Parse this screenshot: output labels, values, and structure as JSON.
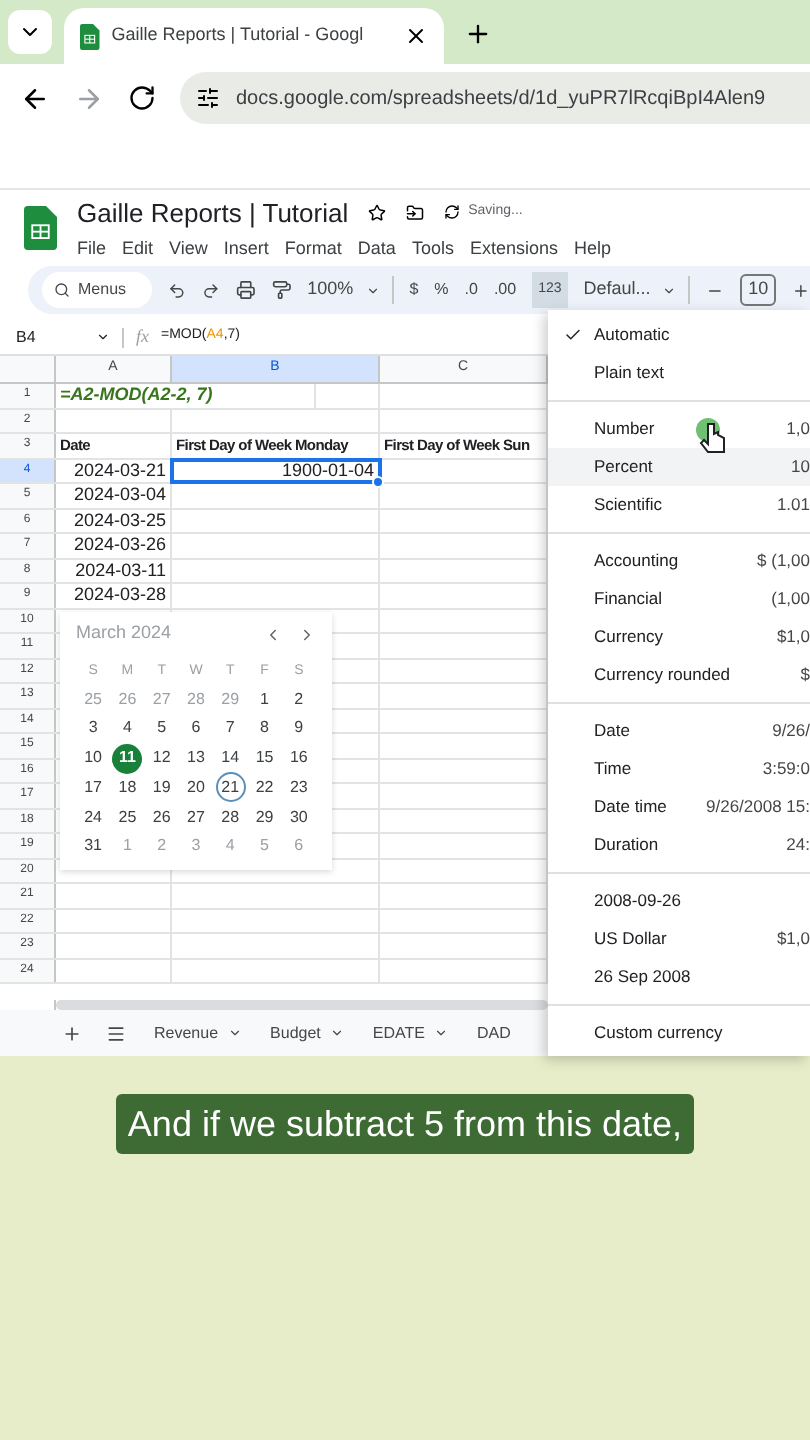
{
  "browser": {
    "tab_title": "Gaille Reports | Tutorial - Googl",
    "url": "docs.google.com/spreadsheets/d/1d_yuPR7lRcqiBpI4Alen9"
  },
  "document": {
    "title": "Gaille Reports | Tutorial",
    "status": "Saving...",
    "menu": [
      "File",
      "Edit",
      "View",
      "Insert",
      "Format",
      "Data",
      "Tools",
      "Extensions",
      "Help"
    ]
  },
  "toolbar": {
    "search": "Menus",
    "zoom": "100%",
    "currency": "$",
    "percent": "%",
    "decrease_decimals": ".0",
    "increase_decimals": ".00",
    "format_button": {
      "label": "123",
      "selected": true
    },
    "font": "Defaul...",
    "font_size": "10"
  },
  "formula_bar": {
    "cell": "B4",
    "fx_label": "fx",
    "formula": [
      {
        "text": "=MOD(",
        "kind": "plain"
      },
      {
        "text": "A4",
        "kind": "ref"
      },
      {
        "text": ",7)",
        "kind": "plain"
      }
    ]
  },
  "grid": {
    "columns": [
      {
        "label": "A",
        "selected": false
      },
      {
        "label": "B",
        "selected": true
      },
      {
        "label": "C",
        "selected": false
      }
    ],
    "rows": [
      {
        "number": "1",
        "selected": false,
        "a": {
          "text": "=A2-MOD(A2-2, 7)",
          "kind": "formula",
          "selected": false
        }
      },
      {
        "number": "2",
        "selected": false
      },
      {
        "number": "3",
        "selected": false,
        "a": {
          "text": "Date",
          "kind": "header",
          "selected": false
        },
        "b": {
          "text": "First Day of Week Monday",
          "kind": "header",
          "selected": false
        },
        "c": {
          "text": "First Day of Week Sun",
          "kind": "header",
          "selected": false
        }
      },
      {
        "number": "4",
        "selected": true,
        "a": {
          "text": "2024-03-21",
          "kind": "value",
          "selected": false
        },
        "b": {
          "text": "1900-01-04",
          "kind": "value",
          "selected": true
        }
      },
      {
        "number": "5",
        "selected": false,
        "a": {
          "text": "2024-03-04",
          "kind": "value",
          "selected": false
        }
      },
      {
        "number": "6",
        "selected": false,
        "a": {
          "text": "2024-03-25",
          "kind": "value",
          "selected": false
        }
      },
      {
        "number": "7",
        "selected": false,
        "a": {
          "text": "2024-03-26",
          "kind": "value",
          "selected": false
        }
      },
      {
        "number": "8",
        "selected": false,
        "a": {
          "text": "2024-03-11",
          "kind": "value",
          "selected": false
        }
      },
      {
        "number": "9",
        "selected": false,
        "a": {
          "text": "2024-03-28",
          "kind": "value",
          "selected": false
        }
      },
      {
        "number": "10",
        "selected": false
      },
      {
        "number": "11",
        "selected": false
      },
      {
        "number": "12",
        "selected": false
      },
      {
        "number": "13",
        "selected": false
      },
      {
        "number": "14",
        "selected": false
      },
      {
        "number": "15",
        "selected": false
      },
      {
        "number": "16",
        "selected": false
      },
      {
        "number": "17",
        "selected": false
      },
      {
        "number": "18",
        "selected": false
      },
      {
        "number": "19",
        "selected": false
      },
      {
        "number": "20",
        "selected": false
      },
      {
        "number": "21",
        "selected": false
      },
      {
        "number": "22",
        "selected": false
      },
      {
        "number": "23",
        "selected": false
      },
      {
        "number": "24",
        "selected": false
      }
    ]
  },
  "date_picker": {
    "title": "March 2024",
    "weekdays": [
      "S",
      "M",
      "T",
      "W",
      "T",
      "F",
      "S"
    ],
    "weeks": [
      [
        {
          "day": "25",
          "muted": true,
          "selected": false,
          "circled": false
        },
        {
          "day": "26",
          "muted": true,
          "selected": false,
          "circled": false
        },
        {
          "day": "27",
          "muted": true,
          "selected": false,
          "circled": false
        },
        {
          "day": "28",
          "muted": true,
          "selected": false,
          "circled": false
        },
        {
          "day": "29",
          "muted": true,
          "selected": false,
          "circled": false
        },
        {
          "day": "1",
          "muted": false,
          "selected": false,
          "circled": false
        },
        {
          "day": "2",
          "muted": false,
          "selected": false,
          "circled": false
        }
      ],
      [
        {
          "day": "3",
          "muted": false,
          "selected": false,
          "circled": false
        },
        {
          "day": "4",
          "muted": false,
          "selected": false,
          "circled": false
        },
        {
          "day": "5",
          "muted": false,
          "selected": false,
          "circled": false
        },
        {
          "day": "6",
          "muted": false,
          "selected": false,
          "circled": false
        },
        {
          "day": "7",
          "muted": false,
          "selected": false,
          "circled": false
        },
        {
          "day": "8",
          "muted": false,
          "selected": false,
          "circled": false
        },
        {
          "day": "9",
          "muted": false,
          "selected": false,
          "circled": false
        }
      ],
      [
        {
          "day": "10",
          "muted": false,
          "selected": false,
          "circled": false
        },
        {
          "day": "11",
          "muted": false,
          "selected": true,
          "circled": false
        },
        {
          "day": "12",
          "muted": false,
          "selected": false,
          "circled": false
        },
        {
          "day": "13",
          "muted": false,
          "selected": false,
          "circled": false
        },
        {
          "day": "14",
          "muted": false,
          "selected": false,
          "circled": false
        },
        {
          "day": "15",
          "muted": false,
          "selected": false,
          "circled": false
        },
        {
          "day": "16",
          "muted": false,
          "selected": false,
          "circled": false
        }
      ],
      [
        {
          "day": "17",
          "muted": false,
          "selected": false,
          "circled": false
        },
        {
          "day": "18",
          "muted": false,
          "selected": false,
          "circled": false
        },
        {
          "day": "19",
          "muted": false,
          "selected": false,
          "circled": false
        },
        {
          "day": "20",
          "muted": false,
          "selected": false,
          "circled": false
        },
        {
          "day": "21",
          "muted": false,
          "selected": false,
          "circled": true
        },
        {
          "day": "22",
          "muted": false,
          "selected": false,
          "circled": false
        },
        {
          "day": "23",
          "muted": false,
          "selected": false,
          "circled": false
        }
      ],
      [
        {
          "day": "24",
          "muted": false,
          "selected": false,
          "circled": false
        },
        {
          "day": "25",
          "muted": false,
          "selected": false,
          "circled": false
        },
        {
          "day": "26",
          "muted": false,
          "selected": false,
          "circled": false
        },
        {
          "day": "27",
          "muted": false,
          "selected": false,
          "circled": false
        },
        {
          "day": "28",
          "muted": false,
          "selected": false,
          "circled": false
        },
        {
          "day": "29",
          "muted": false,
          "selected": false,
          "circled": false
        },
        {
          "day": "30",
          "muted": false,
          "selected": false,
          "circled": false
        }
      ],
      [
        {
          "day": "31",
          "muted": false,
          "selected": false,
          "circled": false
        },
        {
          "day": "1",
          "muted": true,
          "selected": false,
          "circled": false
        },
        {
          "day": "2",
          "muted": true,
          "selected": false,
          "circled": false
        },
        {
          "day": "3",
          "muted": true,
          "selected": false,
          "circled": false
        },
        {
          "day": "4",
          "muted": true,
          "selected": false,
          "circled": false
        },
        {
          "day": "5",
          "muted": true,
          "selected": false,
          "circled": false
        },
        {
          "day": "6",
          "muted": true,
          "selected": false,
          "circled": false
        }
      ]
    ]
  },
  "sheet_tabs": [
    "Revenue",
    "Budget",
    "EDATE",
    "DAD"
  ],
  "format_menu": {
    "groups": [
      [
        {
          "label": "Automatic",
          "checked": true,
          "highlighted": false
        },
        {
          "label": "Plain text",
          "checked": false,
          "highlighted": false
        }
      ],
      [
        {
          "label": "Number",
          "sample": "1,0",
          "checked": false,
          "highlighted": false
        },
        {
          "label": "Percent",
          "sample": "10",
          "checked": false,
          "highlighted": true
        },
        {
          "label": "Scientific",
          "sample": "1.01",
          "checked": false,
          "highlighted": false
        }
      ],
      [
        {
          "label": "Accounting",
          "sample": "$ (1,00",
          "checked": false,
          "highlighted": false
        },
        {
          "label": "Financial",
          "sample": "(1,00",
          "checked": false,
          "highlighted": false
        },
        {
          "label": "Currency",
          "sample": "$1,0",
          "checked": false,
          "highlighted": false
        },
        {
          "label": "Currency rounded",
          "sample": "$",
          "checked": false,
          "highlighted": false
        }
      ],
      [
        {
          "label": "Date",
          "sample": "9/26/",
          "checked": false,
          "highlighted": false
        },
        {
          "label": "Time",
          "sample": "3:59:0",
          "checked": false,
          "highlighted": false
        },
        {
          "label": "Date time",
          "sample": "9/26/2008 15:",
          "checked": false,
          "highlighted": false
        },
        {
          "label": "Duration",
          "sample": "24:",
          "checked": false,
          "highlighted": false
        }
      ],
      [
        {
          "label": "2008-09-26",
          "checked": false,
          "highlighted": false
        },
        {
          "label": "US Dollar",
          "sample": "$1,0",
          "checked": false,
          "highlighted": false
        },
        {
          "label": "26 Sep 2008",
          "checked": false,
          "highlighted": false
        }
      ],
      [
        {
          "label": "Custom currency",
          "checked": false,
          "highlighted": false
        }
      ]
    ]
  },
  "caption": "And if we subtract 5 from this date,"
}
